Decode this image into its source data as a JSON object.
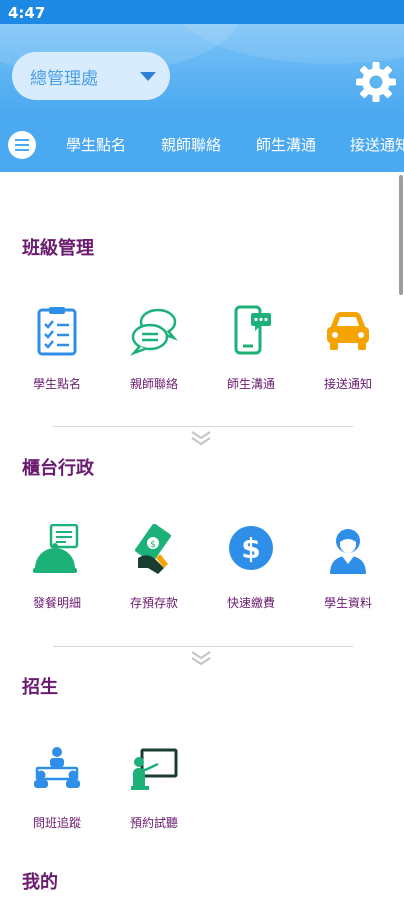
{
  "status_bar": {
    "time": "4:47"
  },
  "header": {
    "branch_selector": {
      "value": "總管理處",
      "icon": "caret-down-icon"
    },
    "settings": {
      "icon": "gear-icon"
    }
  },
  "nav": {
    "menu_icon": "menu-icon",
    "tabs": [
      {
        "label": "學生點名"
      },
      {
        "label": "親師聯絡"
      },
      {
        "label": "師生溝通"
      },
      {
        "label": "接送通知"
      }
    ]
  },
  "sections": {
    "class_management": {
      "title": "班級管理",
      "items": [
        {
          "label": "學生點名",
          "icon": "clipboard-checklist-icon"
        },
        {
          "label": "親師聯絡",
          "icon": "chat-bubbles-icon"
        },
        {
          "label": "師生溝通",
          "icon": "smartphone-message-icon"
        },
        {
          "label": "接送通知",
          "icon": "car-icon"
        }
      ]
    },
    "front_desk": {
      "title": "櫃台行政",
      "items": [
        {
          "label": "發餐明細",
          "icon": "meal-cloche-icon"
        },
        {
          "label": "存預存款",
          "icon": "money-deposit-icon"
        },
        {
          "label": "快速繳費",
          "icon": "dollar-circle-icon"
        },
        {
          "label": "學生資料",
          "icon": "student-profile-icon"
        }
      ]
    },
    "enrollment": {
      "title": "招生",
      "items": [
        {
          "label": "問班追蹤",
          "icon": "meeting-group-icon"
        },
        {
          "label": "預約試聽",
          "icon": "teacher-blackboard-icon"
        }
      ]
    },
    "mine": {
      "title": "我的"
    }
  },
  "colors": {
    "status_bar": "#1e88e5",
    "nav_bar": "#4ba9f2",
    "section_title": "#6a1b6f",
    "icon_blue": "#2e8ee8",
    "icon_green": "#1db17a",
    "icon_orange": "#f5a300"
  }
}
